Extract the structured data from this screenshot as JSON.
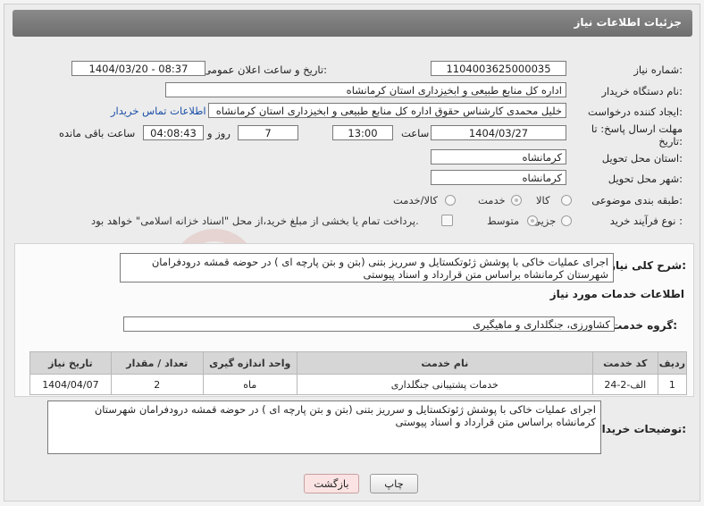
{
  "header": {
    "title": "جزئیات اطلاعات نیاز"
  },
  "fields": {
    "need_number_label": "شماره نیاز:",
    "need_number": "1104003625000035",
    "announce_label": "تاریخ و ساعت اعلان عمومی:",
    "announce_value": "1404/03/20 - 08:37",
    "buyer_org_label": "نام دستگاه خریدار:",
    "buyer_org": "اداره کل منابع طبیعی و ابخیزداری استان کرمانشاه",
    "creator_label": "ایجاد کننده درخواست:",
    "creator": "خلیل محمدی کارشناس حقوق اداره کل منابع طبیعی و ابخیزداری استان کرمانشاه",
    "contact_link": "اطلاعات تماس خریدار",
    "deadline_label_1": "مهلت ارسال پاسخ: تا",
    "deadline_label_2": "تاریخ:",
    "deadline_date": "1404/03/27",
    "time_label": "ساعت",
    "deadline_time": "13:00",
    "days_value": "7",
    "days_label": "روز و",
    "remaining_time": "04:08:43",
    "remaining_label": "ساعت باقی مانده",
    "province_label": "استان محل تحویل:",
    "province": "کرمانشاه",
    "city_label": "شهر محل تحویل:",
    "city": "کرمانشاه",
    "category_label": "طبقه بندی موضوعی:",
    "category_options": [
      "کالا",
      "خدمت",
      "کالا/خدمت"
    ],
    "category_selected": "خدمت",
    "process_label": "نوع فرآیند خرید :",
    "process_options": [
      "جزیی",
      "متوسط"
    ],
    "process_selected": "متوسط",
    "payment_note": "پرداخت تمام یا بخشی از مبلغ خرید،از محل \"اسناد خزانه اسلامی\" خواهد بود."
  },
  "summary": {
    "label": "شرح کلی نیاز:",
    "text": "اجرای عملیات خاکی با پوشش ژئوتکستایل و سرریز بتنی (بتن و بتن پارچه ای ) در حوضه قمشه درودفرامان شهرستان کرمانشاه براساس متن قرارداد و اسناد پیوستی"
  },
  "services": {
    "section_title": "اطلاعات خدمات مورد نیاز",
    "group_label": "گروه خدمت:",
    "group_value": "کشاورزی، جنگلداری و ماهیگیری",
    "columns": [
      "ردیف",
      "کد خدمت",
      "نام خدمت",
      "واحد اندازه گیری",
      "تعداد / مقدار",
      "تاریخ نیاز"
    ],
    "rows": [
      [
        "1",
        "الف-2-24",
        "خدمات پشتیبانی جنگلداری",
        "ماه",
        "2",
        "1404/04/07"
      ]
    ]
  },
  "buyer_notes": {
    "label": "توضیحات خریدار:",
    "text": "اجرای عملیات خاکی با پوشش ژئوتکستایل و سرریز بتنی (بتن و بتن پارچه ای ) در حوضه قمشه درودفرامان شهرستان کرمانشاه براساس متن قرارداد و اسناد پیوستی"
  },
  "buttons": {
    "print": "چاپ",
    "back": "بازگشت"
  },
  "watermark_text": "AriaTender.net",
  "colors": {
    "header_bg": "#7a7a7a",
    "link": "#1a4fa8",
    "back_button_bg": "#fbe3e3",
    "watermark": "#c0392b"
  }
}
